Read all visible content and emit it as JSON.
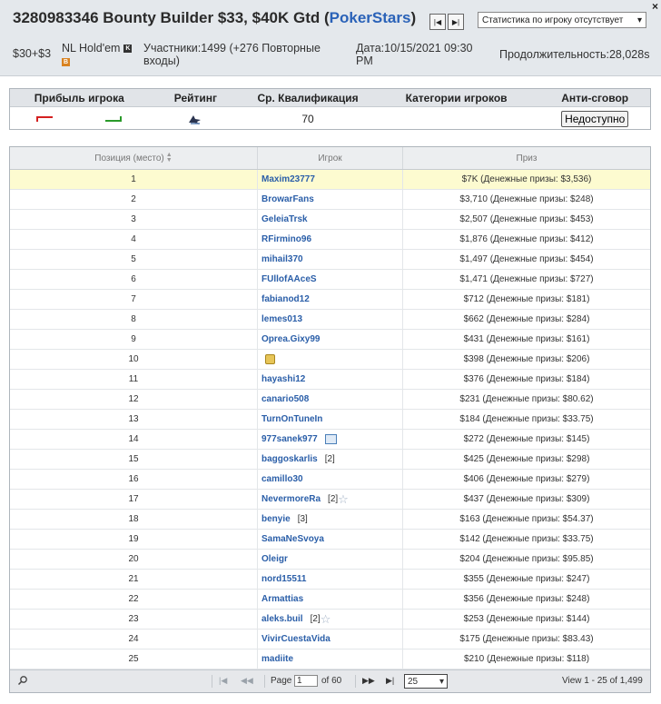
{
  "header": {
    "close": "×",
    "title_main": "3280983346 Bounty Builder $33, $40K Gtd (",
    "title_room": "PokerStars",
    "title_end": ")",
    "nav_first": "|◀",
    "nav_last": "▶|",
    "stats_select": "Статистика по игроку отсутствует",
    "buyin": "$30+$3",
    "game": "NL Hold'em",
    "badge_k": "K",
    "badge_b": "B",
    "participants_line1": "Участники:1499 (+276 Повторные",
    "participants_line2": "входы)",
    "date_line1": "Дата:10/15/2021 09:30",
    "date_line2": "PM",
    "duration": "Продолжительность:28,028s"
  },
  "summary": {
    "headers": [
      "Прибыль игрока",
      "Рейтинг",
      "Ср. Квалификация",
      "Категории игроков",
      "Анти-сговор"
    ],
    "avg_qual": "70",
    "anti_collusion": "Недоступно",
    "colors": {
      "profit_red": "#d42020",
      "profit_green": "#2a9a2a"
    }
  },
  "grid": {
    "headers": {
      "position": "Позиция (место)",
      "player": "Игрок",
      "prize": "Приз"
    },
    "rows": [
      {
        "pos": "1",
        "player": "Maxim23777",
        "prize": "$7K  (Денежные призы: $3,536)",
        "highlight": true
      },
      {
        "pos": "2",
        "player": "BrowarFans",
        "prize": "$3,710  (Денежные призы: $248)"
      },
      {
        "pos": "3",
        "player": "GeleiaTrsk",
        "prize": "$2,507  (Денежные призы: $453)"
      },
      {
        "pos": "4",
        "player": "RFirmino96",
        "prize": "$1,876  (Денежные призы: $412)"
      },
      {
        "pos": "5",
        "player": "mihail370",
        "prize": "$1,497  (Денежные призы: $454)"
      },
      {
        "pos": "6",
        "player": "FUllofAAceS",
        "prize": "$1,471  (Денежные призы: $727)"
      },
      {
        "pos": "7",
        "player": "fabianod12",
        "prize": "$712  (Денежные призы: $181)"
      },
      {
        "pos": "8",
        "player": "lemes013",
        "prize": "$662  (Денежные призы: $284)"
      },
      {
        "pos": "9",
        "player": "Oprea.Gixy99",
        "prize": "$431  (Денежные призы: $161)"
      },
      {
        "pos": "10",
        "player": "",
        "icon": "lock",
        "prize": "$398  (Денежные призы: $206)"
      },
      {
        "pos": "11",
        "player": "hayashi12",
        "prize": "$376  (Денежные призы: $184)"
      },
      {
        "pos": "12",
        "player": "canario508",
        "prize": "$231  (Денежные призы: $80.62)"
      },
      {
        "pos": "13",
        "player": "TurnOnTuneIn",
        "prize": "$184  (Денежные призы: $33.75)"
      },
      {
        "pos": "14",
        "player": "977sanek977",
        "icon": "export",
        "prize": "$272  (Денежные призы: $145)"
      },
      {
        "pos": "15",
        "player": "baggoskarlis",
        "count": "[2]",
        "prize": "$425  (Денежные призы: $298)"
      },
      {
        "pos": "16",
        "player": "camillo30",
        "prize": "$406  (Денежные призы: $279)"
      },
      {
        "pos": "17",
        "player": "NevermoreRa",
        "count": "[2]",
        "icon": "star",
        "prize": "$437  (Денежные призы: $309)"
      },
      {
        "pos": "18",
        "player": "benyie",
        "count": "[3]",
        "prize": "$163  (Денежные призы: $54.37)"
      },
      {
        "pos": "19",
        "player": "SamaNeSvoya",
        "prize": "$142  (Денежные призы: $33.75)"
      },
      {
        "pos": "20",
        "player": "Oleigr",
        "prize": "$204  (Денежные призы: $95.85)"
      },
      {
        "pos": "21",
        "player": "nord15511",
        "prize": "$355  (Денежные призы: $247)"
      },
      {
        "pos": "22",
        "player": "Armattias",
        "prize": "$356  (Денежные призы: $248)"
      },
      {
        "pos": "23",
        "player": "aleks.buil",
        "count": "[2]",
        "icon": "star",
        "prize": "$253  (Денежные призы: $144)"
      },
      {
        "pos": "24",
        "player": "VivirCuestaVida",
        "prize": "$175  (Денежные призы: $83.43)"
      },
      {
        "pos": "25",
        "player": "madiite",
        "prize": "$210  (Денежные призы: $118)"
      }
    ]
  },
  "pager": {
    "page_label": "Page",
    "page_value": "1",
    "of_label": "of 60",
    "page_size": "25",
    "view_text": "View 1 - 25 of 1,499"
  }
}
